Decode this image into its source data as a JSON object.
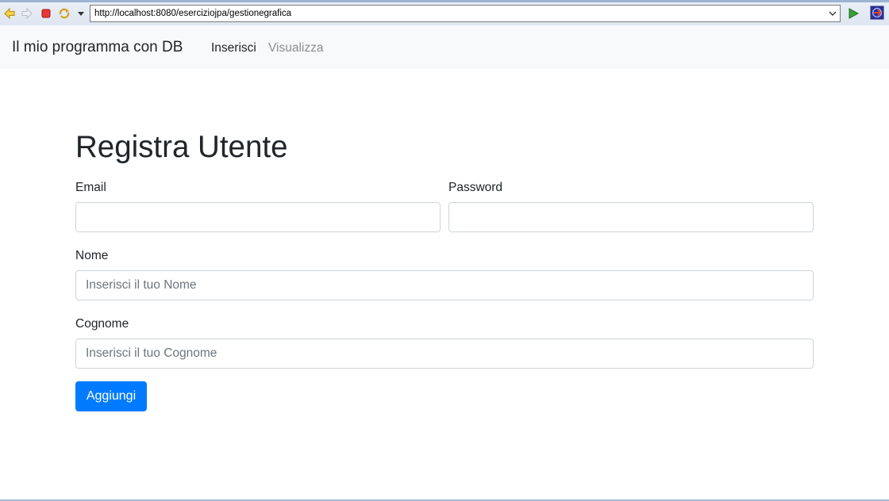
{
  "browser": {
    "url": "http://localhost:8080/eserciziojpa/gestionegrafica",
    "icons": [
      "back-icon",
      "forward-icon",
      "stop-icon",
      "refresh-icon",
      "dropdown-icon",
      "go-icon",
      "app-icon"
    ]
  },
  "navbar": {
    "brand": "Il mio programma con DB",
    "links": [
      {
        "label": "Inserisci",
        "active": true
      },
      {
        "label": "Visualizza",
        "active": false
      }
    ]
  },
  "form": {
    "title": "Registra Utente",
    "email": {
      "label": "Email",
      "value": "",
      "placeholder": ""
    },
    "password": {
      "label": "Password",
      "value": "",
      "placeholder": ""
    },
    "nome": {
      "label": "Nome",
      "value": "",
      "placeholder": "Inserisci il tuo Nome"
    },
    "cognome": {
      "label": "Cognome",
      "value": "",
      "placeholder": "Inserisci il tuo Cognome"
    },
    "submit_label": "Aggiungi"
  },
  "colors": {
    "primary": "#007bff",
    "navbar_bg": "#f8f9fa",
    "input_border": "#ced4da"
  }
}
